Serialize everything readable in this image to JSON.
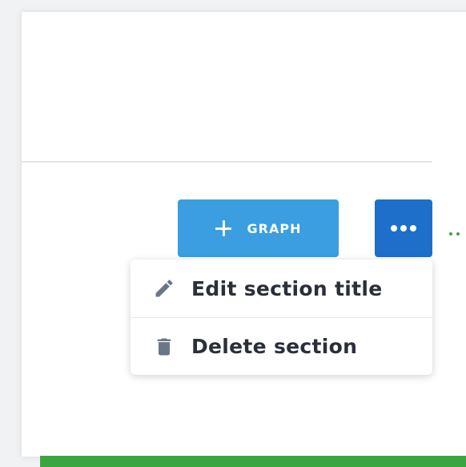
{
  "toolbar": {
    "graph_button": {
      "icon": "plus-icon",
      "label": "GRAPH"
    },
    "more_button": {
      "icon": "ellipsis-icon"
    }
  },
  "dropdown_menu": {
    "items": [
      {
        "icon": "pencil-icon",
        "label": "Edit section title"
      },
      {
        "icon": "trash-icon",
        "label": "Delete section"
      }
    ]
  },
  "colors": {
    "graph_button_bg": "#3a9ee0",
    "more_button_bg": "#1e6fc9",
    "menu_text": "#2a2f3a",
    "menu_icon": "#6b7689",
    "green_accent": "#3aa640"
  }
}
